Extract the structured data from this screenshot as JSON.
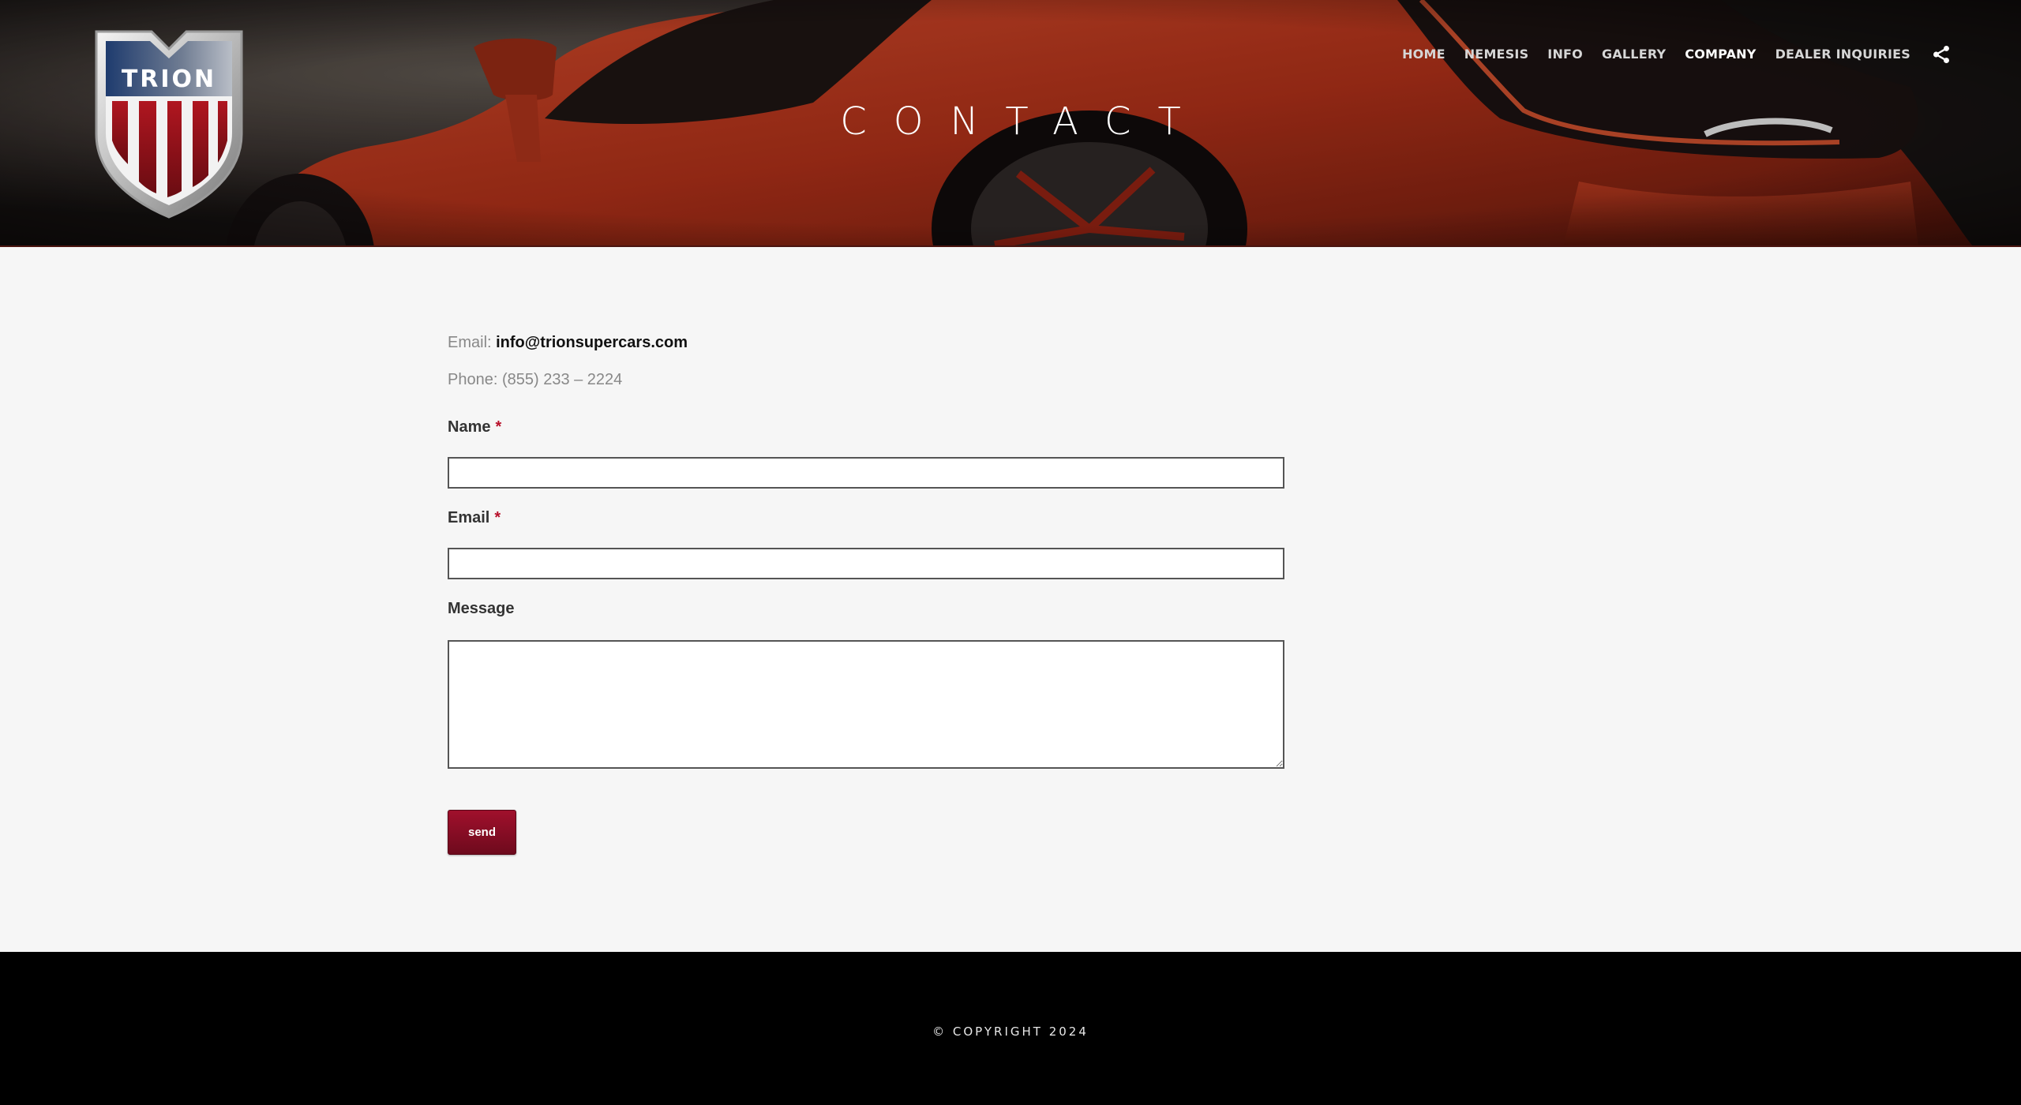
{
  "header": {
    "logo_text": "TRION",
    "page_title": "CONTACT"
  },
  "nav": {
    "items": [
      {
        "label": "HOME",
        "active": false
      },
      {
        "label": "NEMESIS",
        "active": false
      },
      {
        "label": "INFO",
        "active": false
      },
      {
        "label": "GALLERY",
        "active": false
      },
      {
        "label": "COMPANY",
        "active": true
      },
      {
        "label": "DEALER INQUIRIES",
        "active": false
      }
    ],
    "share_icon": "share-icon"
  },
  "contact": {
    "email_prefix": "Email: ",
    "email_value": "info@trionsupercars.com",
    "phone_text": "Phone: (855) 233 – 2224"
  },
  "form": {
    "name_label": "Name",
    "email_label": "Email",
    "message_label": "Message",
    "required_marker": "*",
    "name_value": "",
    "email_value": "",
    "message_value": "",
    "send_label": "send"
  },
  "footer": {
    "copyright": "© COPYRIGHT 2024"
  },
  "colors": {
    "accent": "#8a0c24",
    "required": "#b8102a",
    "footer_bg": "#000000",
    "page_bg": "#f6f6f6"
  }
}
